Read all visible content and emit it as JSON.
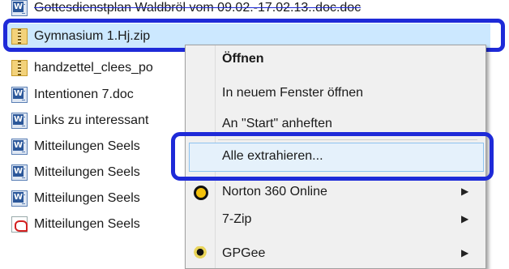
{
  "files": [
    {
      "name": "Gottesdienstplan Waldbröl vom 09.02.-17.02.13..doc.doc",
      "icon": "word-doc-icon"
    },
    {
      "name": "Gymnasium 1.Hj.zip",
      "icon": "zip-folder-icon",
      "selected": true
    },
    {
      "name": "handzettel_clees_po",
      "icon": "zip-folder-icon"
    },
    {
      "name": "Intentionen 7.doc",
      "icon": "word-doc-icon"
    },
    {
      "name": "Links zu interessant",
      "icon": "word-doc-icon"
    },
    {
      "name": "Mitteilungen  Seels",
      "icon": "word-doc-icon"
    },
    {
      "name": "Mitteilungen  Seels",
      "icon": "word-doc-icon"
    },
    {
      "name": "Mitteilungen  Seels",
      "icon": "word-doc-icon"
    },
    {
      "name": "Mitteilungen  Seels",
      "icon": "pdf-icon"
    }
  ],
  "context_menu": {
    "items": [
      {
        "label": "Öffnen",
        "bold": true
      },
      {
        "label": "In neuem Fenster öffnen"
      },
      {
        "label": "An \"Start\" anheften"
      },
      {
        "label": "Alle extrahieren...",
        "highlighted": true
      },
      {
        "label": "Norton 360 Online",
        "submenu": true,
        "icon": "norton-icon"
      },
      {
        "label": "7-Zip",
        "submenu": true
      },
      {
        "label": "GPGee",
        "submenu": true,
        "icon": "gpg-key-icon"
      }
    ]
  },
  "colors": {
    "annotation": "#1e2ad8",
    "selection": "#cce8ff",
    "menu_background": "#f0f0f0",
    "hover": "#e5f1fb"
  }
}
